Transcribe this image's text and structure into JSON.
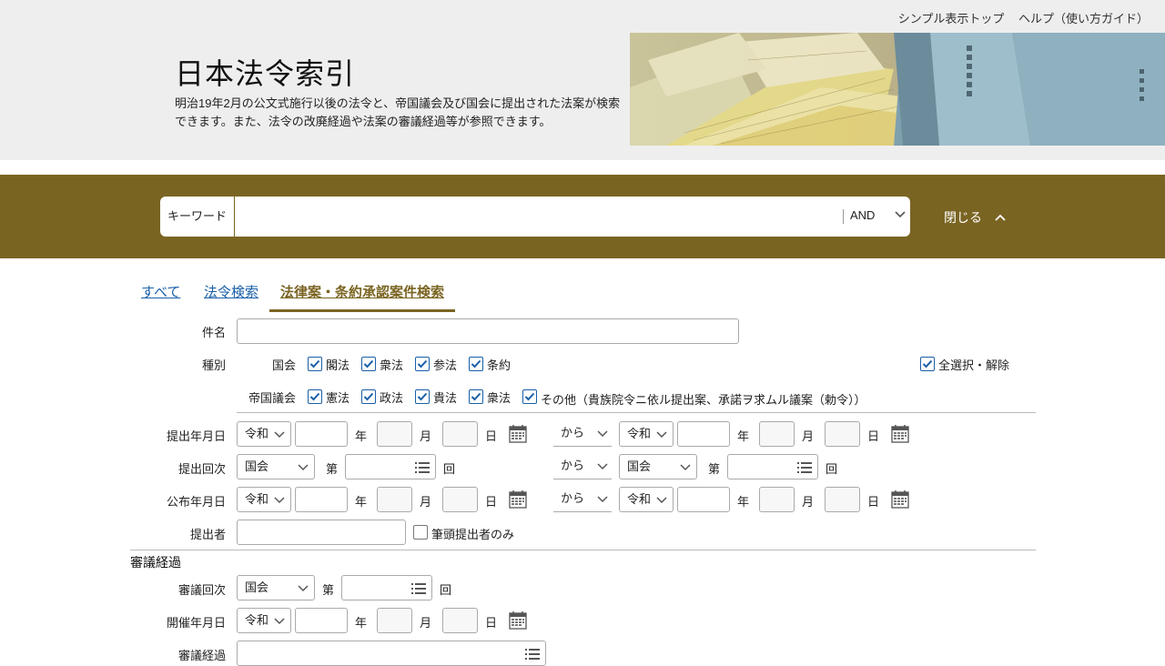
{
  "header": {
    "links": [
      "シンプル表示トップ",
      "ヘルプ（使い方ガイド）"
    ],
    "title": "日本法令索引",
    "description": "明治19年2月の公文式施行以後の法令と、帝国議会及び国会に提出された法案が検索できます。また、法令の改廃経過や法案の審議経過等が参照できます。"
  },
  "search": {
    "keyword_label": "キーワード",
    "keyword_value": "",
    "operator": "AND",
    "close_label": "閉じる"
  },
  "tabs": [
    {
      "label": "すべて",
      "active": false
    },
    {
      "label": "法令検索",
      "active": false
    },
    {
      "label": "法律案・条約承認案件検索",
      "active": true
    }
  ],
  "form": {
    "subject_label": "件名",
    "type_label": "種別",
    "kokkai_label": "国会",
    "kokkai_types": [
      "閣法",
      "衆法",
      "参法",
      "条約"
    ],
    "select_all_label": "全選択・解除",
    "teikoku_label": "帝国議会",
    "teikoku_types": [
      "憲法",
      "政法",
      "貴法",
      "衆法",
      "その他（貴族院令ニ依ル提出案、承諾ヲ求ムル議案（勅令））"
    ],
    "submit_date_label": "提出年月日",
    "submit_session_label": "提出回次",
    "promulgation_date_label": "公布年月日",
    "submitter_label": "提出者",
    "lead_submitter_only_label": "筆頭提出者のみ",
    "era": "令和",
    "assembly": "国会",
    "range_from": "から",
    "year_unit": "年",
    "month_unit": "月",
    "day_unit": "日",
    "ordinal_prefix": "第",
    "session_unit": "回"
  },
  "deliberation": {
    "section_title": "審議経過",
    "session_label": "審議回次",
    "meeting_date_label": "開催年月日",
    "progress_label": "審議経過"
  },
  "colors": {
    "brand": "#7a6422",
    "link": "#1a5fa8",
    "header_bg": "#eeeeee"
  }
}
